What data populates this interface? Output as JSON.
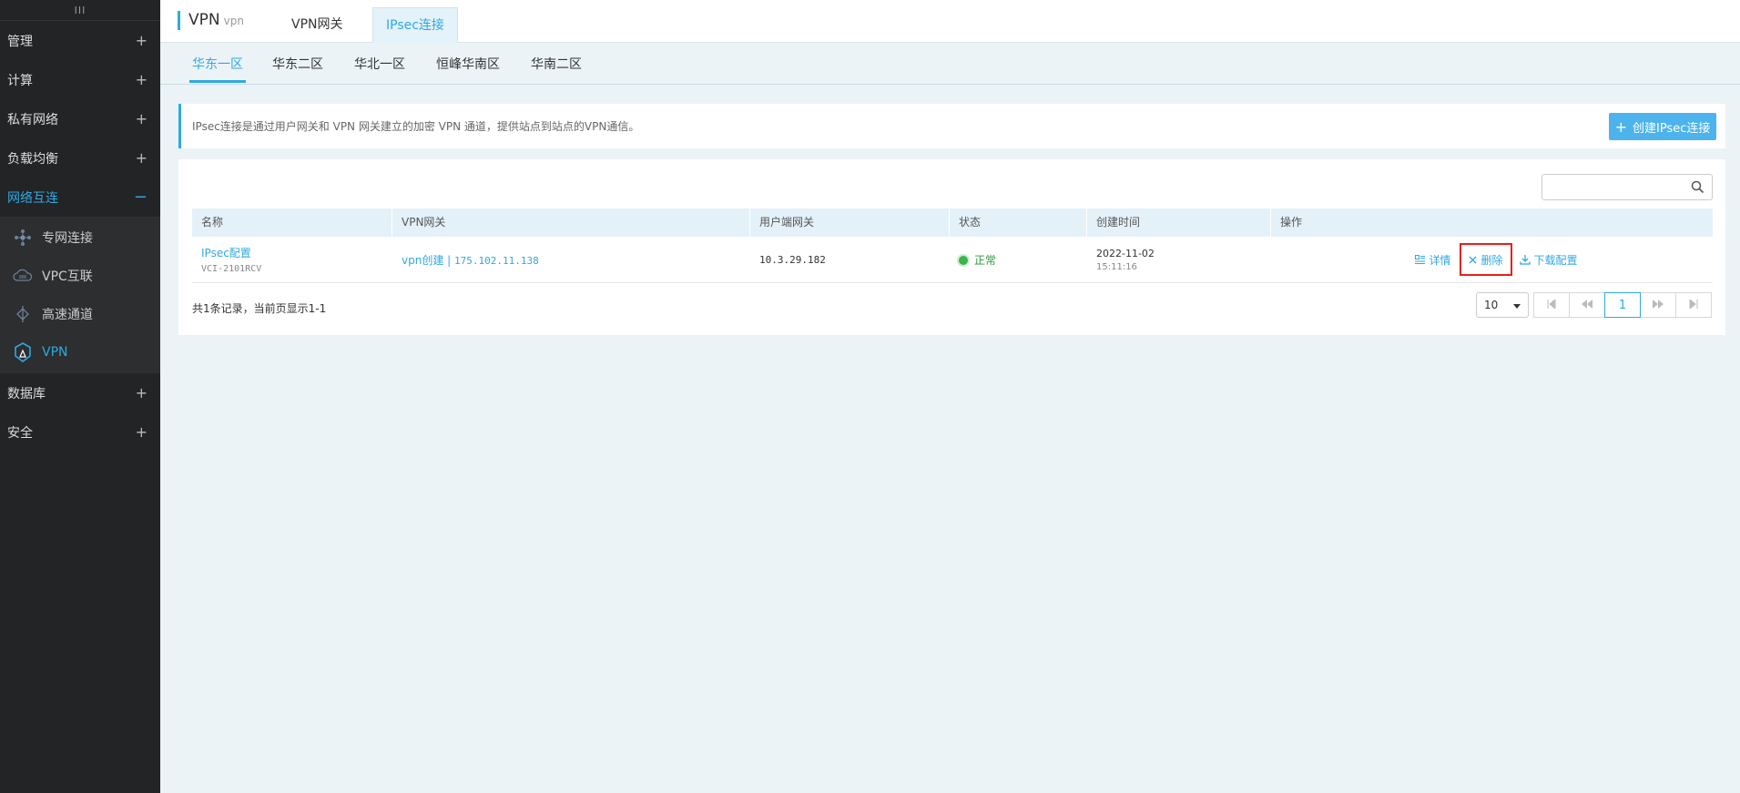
{
  "sidebar": {
    "top_glyph": "III",
    "sections": [
      {
        "label": "管理",
        "toggle": "+"
      },
      {
        "label": "计算",
        "toggle": "+"
      },
      {
        "label": "私有网络",
        "toggle": "+"
      },
      {
        "label": "负载均衡",
        "toggle": "+"
      },
      {
        "label": "网络互连",
        "toggle": "−"
      },
      {
        "label": "数据库",
        "toggle": "+"
      },
      {
        "label": "安全",
        "toggle": "+"
      }
    ],
    "sub_items": [
      {
        "label": "专网连接",
        "icon": "dedicated-line-icon"
      },
      {
        "label": "VPC互联",
        "icon": "vpc-interconnect-icon"
      },
      {
        "label": "高速通道",
        "icon": "express-channel-icon"
      },
      {
        "label": "VPN",
        "icon": "vpn-icon"
      }
    ]
  },
  "header": {
    "title": "VPN",
    "subtitle": "vpn",
    "tabs": [
      {
        "label": "VPN网关"
      },
      {
        "label": "IPsec连接"
      }
    ]
  },
  "regions": [
    {
      "label": "华东一区"
    },
    {
      "label": "华东二区"
    },
    {
      "label": "华北一区"
    },
    {
      "label": "恒峰华南区"
    },
    {
      "label": "华南二区"
    }
  ],
  "info": {
    "text": "IPsec连接是通过用户网关和 VPN 网关建立的加密 VPN 通道，提供站点到站点的VPN通信。",
    "create_button": "创建IPsec连接"
  },
  "search": {
    "placeholder": ""
  },
  "table": {
    "headers": [
      "名称",
      "VPN网关",
      "用户端网关",
      "状态",
      "创建时间",
      "操作"
    ],
    "rows": [
      {
        "name": "IPsec配置",
        "id": "VCI-2101RCV",
        "gateway_name": "vpn创建",
        "gateway_sep": " | ",
        "gateway_ip": "175.102.11.138",
        "customer_gateway": "10.3.29.182",
        "status": "正常",
        "created_date": "2022-11-02",
        "created_time": "15:11:16",
        "actions": {
          "detail": "详情",
          "delete": "删除",
          "download": "下载配置"
        }
      }
    ]
  },
  "footer": {
    "count_text": "共1条记录，当前页显示1-1",
    "page_size": "10",
    "current_page": "1"
  },
  "colors": {
    "accent": "#2fa9e2",
    "sidebar_bg": "#222426",
    "status_ok": "#3bb44a",
    "highlight": "#e8201c"
  }
}
